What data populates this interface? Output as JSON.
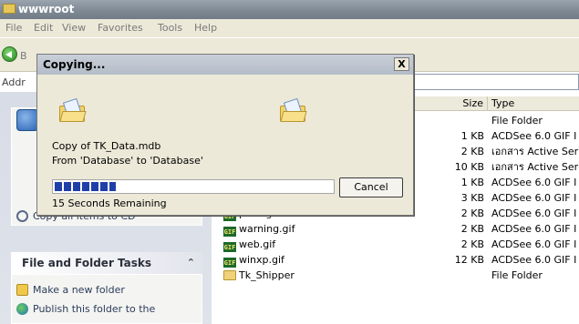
{
  "window": {
    "title": "wwwroot"
  },
  "menu": [
    "File",
    "Edit",
    "View",
    "Favorites",
    "Tools",
    "Help"
  ],
  "toolbar": {
    "back_label": "B"
  },
  "address": {
    "label": "Addr"
  },
  "left_pane": {
    "tasks_top": [
      {
        "label": "Copy all items to CD",
        "icon": "copy-icon"
      }
    ],
    "file_folder_tasks": {
      "header": "File and Folder Tasks",
      "items": [
        {
          "label": "Make a new folder",
          "icon": "new-folder-icon"
        },
        {
          "label": "Publish this folder to the",
          "icon": "globe-icon"
        }
      ]
    }
  },
  "columns": {
    "size": "Size",
    "type": "Type"
  },
  "files": [
    {
      "name": "",
      "size": "",
      "type": "File Folder",
      "icon": "none"
    },
    {
      "name": "",
      "size": "1 KB",
      "type": "ACDSee 6.0 GIF I",
      "icon": "none"
    },
    {
      "name": "",
      "size": "2 KB",
      "type": "เอกสาร Active Ser",
      "icon": "none"
    },
    {
      "name": "",
      "size": "10 KB",
      "type": "เอกสาร Active Ser",
      "icon": "none"
    },
    {
      "name": "",
      "size": "1 KB",
      "type": "ACDSee 6.0 GIF I",
      "icon": "none"
    },
    {
      "name": "",
      "size": "3 KB",
      "type": "ACDSee 6.0 GIF I",
      "icon": "none"
    },
    {
      "name": "print.gif",
      "size": "2 KB",
      "type": "ACDSee 6.0 GIF I",
      "icon": "gif-icon"
    },
    {
      "name": "warning.gif",
      "size": "2 KB",
      "type": "ACDSee 6.0 GIF I",
      "icon": "gif-icon"
    },
    {
      "name": "web.gif",
      "size": "2 KB",
      "type": "ACDSee 6.0 GIF I",
      "icon": "gif-icon"
    },
    {
      "name": "winxp.gif",
      "size": "12 KB",
      "type": "ACDSee 6.0 GIF I",
      "icon": "gif-icon"
    },
    {
      "name": "Tk_Shipper",
      "size": "",
      "type": "File Folder",
      "icon": "folder-icon"
    }
  ],
  "dialog": {
    "title": "Copying...",
    "close_label": "X",
    "file_line": "Copy of TK_Data.mdb",
    "from_line": "From 'Database' to 'Database'",
    "remaining": "15 Seconds Remaining",
    "cancel_label": "Cancel",
    "progress": 0.22
  },
  "colors": {
    "progress": "#1f3fa8",
    "titlebar": "#7d8893",
    "dialog_bg": "#ece9d8"
  }
}
